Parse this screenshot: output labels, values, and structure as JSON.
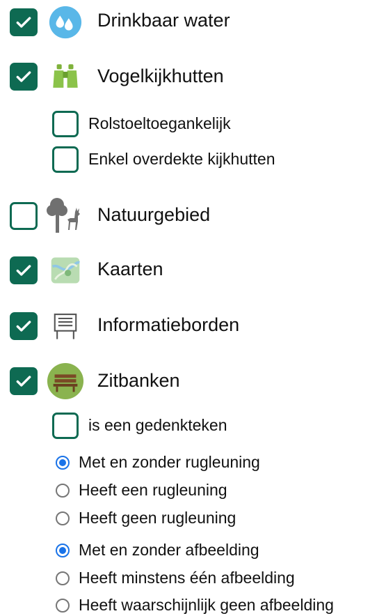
{
  "layers": [
    {
      "label": "Drinkbaar water",
      "checked": true,
      "icon": "water-drop-icon"
    },
    {
      "label": "Vogelkijkhutten",
      "checked": true,
      "icon": "binoculars-icon",
      "options": [
        {
          "label": "Rolstoeltoegankelijk",
          "checked": false
        },
        {
          "label": "Enkel overdekte kijkhutten",
          "checked": false
        }
      ]
    },
    {
      "label": "Natuurgebied",
      "checked": false,
      "icon": "tree-deer-icon"
    },
    {
      "label": "Kaarten",
      "checked": true,
      "icon": "map-icon"
    },
    {
      "label": "Informatieborden",
      "checked": true,
      "icon": "info-board-icon"
    },
    {
      "label": "Zitbanken",
      "checked": true,
      "icon": "bench-icon",
      "options": [
        {
          "label": "is een gedenkteken",
          "checked": false
        }
      ],
      "radio_groups": [
        {
          "options": [
            "Met en zonder rugleuning",
            "Heeft een rugleuning",
            "Heeft geen rugleuning"
          ],
          "selected": 0
        },
        {
          "options": [
            "Met en zonder afbeelding",
            "Heeft minstens één afbeelding",
            "Heeft waarschijnlijk geen afbeelding"
          ],
          "selected": 0
        }
      ]
    }
  ],
  "colors": {
    "accent": "#0e6a52",
    "radio_selected": "#1a73e8"
  }
}
